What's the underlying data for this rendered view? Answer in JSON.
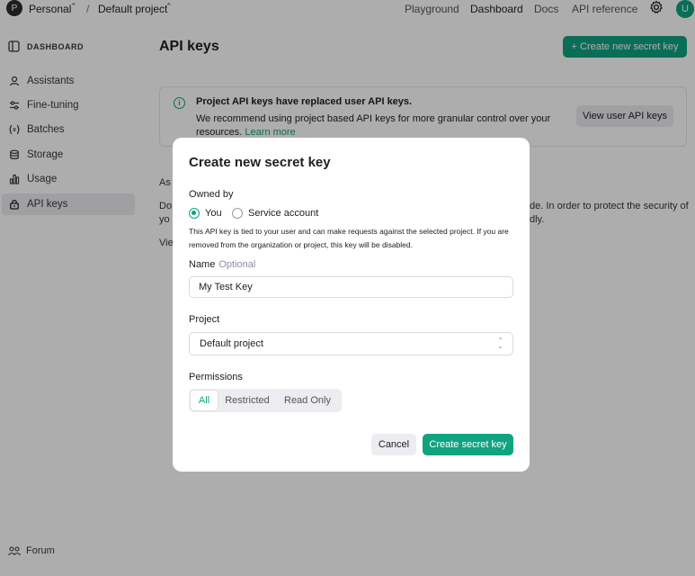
{
  "topbar": {
    "org_initial": "P",
    "org_name": "Personal",
    "separator": "/",
    "project_name": "Default project",
    "nav": [
      "Playground",
      "Dashboard",
      "Docs",
      "API reference"
    ],
    "active_nav": "Dashboard",
    "user_initial": "U"
  },
  "sidebar": {
    "header": "DASHBOARD",
    "items": [
      {
        "label": "Assistants",
        "icon": "assistants-icon"
      },
      {
        "label": "Fine-tuning",
        "icon": "fine-tuning-icon"
      },
      {
        "label": "Batches",
        "icon": "batches-icon"
      },
      {
        "label": "Storage",
        "icon": "storage-icon"
      },
      {
        "label": "Usage",
        "icon": "usage-icon"
      },
      {
        "label": "API keys",
        "icon": "lock-icon"
      }
    ],
    "active": "API keys",
    "footer": "Forum"
  },
  "main": {
    "title": "API keys",
    "create_button": "+ Create new secret key",
    "notice": {
      "title": "Project API keys have replaced user API keys.",
      "body": "We recommend using project based API keys for more granular control over your resources.",
      "link": "Learn more",
      "button": "View user API keys"
    },
    "fragments": {
      "a": "As",
      "b": "Do",
      "c": "yo",
      "d": "Vie",
      "e": "de. In order to protect the security of",
      "f": "dly."
    }
  },
  "modal": {
    "title": "Create new secret key",
    "owned_by_label": "Owned by",
    "owner_options": [
      "You",
      "Service account"
    ],
    "owner_selected": "You",
    "owner_help": "This API key is tied to your user and can make requests against the selected project. If you are removed from the organization or project, this key will be disabled.",
    "name_label": "Name",
    "name_optional": "Optional",
    "name_value": "My Test Key",
    "project_label": "Project",
    "project_value": "Default project",
    "permissions_label": "Permissions",
    "permission_options": [
      "All",
      "Restricted",
      "Read Only"
    ],
    "permission_selected": "All",
    "cancel": "Cancel",
    "submit": "Create secret key"
  },
  "colors": {
    "accent": "#10a37f",
    "overlay": "rgba(0,0,0,0.32)"
  }
}
